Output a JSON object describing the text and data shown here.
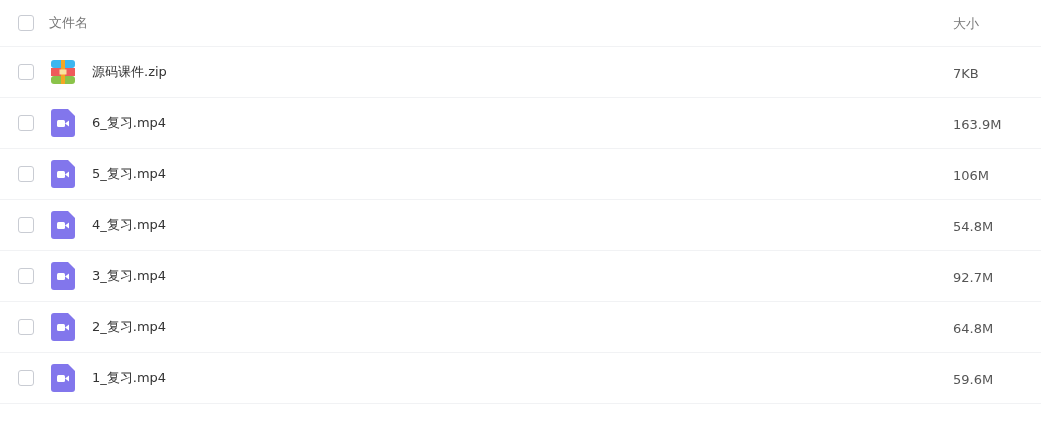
{
  "header": {
    "checked": false,
    "name": "文件名",
    "size": "大小"
  },
  "files": [
    {
      "kind": "archive",
      "name": "源码课件.zip",
      "size": "7KB",
      "checked": false
    },
    {
      "kind": "video",
      "name": "6_复习.mp4",
      "size": "163.9M",
      "checked": false
    },
    {
      "kind": "video",
      "name": "5_复习.mp4",
      "size": "106M",
      "checked": false
    },
    {
      "kind": "video",
      "name": "4_复习.mp4",
      "size": "54.8M",
      "checked": false
    },
    {
      "kind": "video",
      "name": "3_复习.mp4",
      "size": "92.7M",
      "checked": false
    },
    {
      "kind": "video",
      "name": "2_复习.mp4",
      "size": "64.8M",
      "checked": false
    },
    {
      "kind": "video",
      "name": "1_复习.mp4",
      "size": "59.6M",
      "checked": false
    }
  ]
}
